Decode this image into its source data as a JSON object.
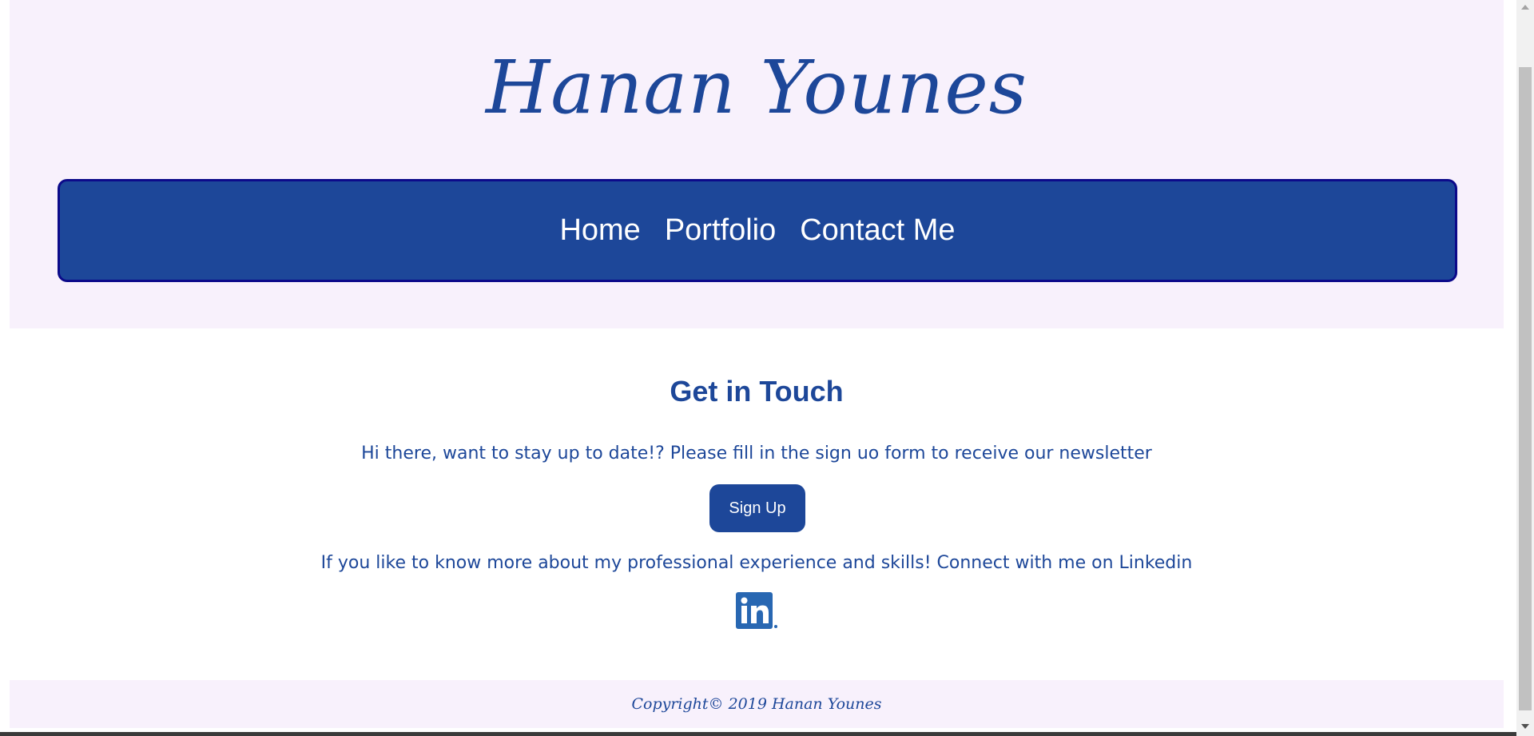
{
  "header": {
    "site_title": "Hanan Younes"
  },
  "nav": {
    "items": [
      {
        "label": "Home"
      },
      {
        "label": "Portfolio"
      },
      {
        "label": "Contact Me"
      }
    ]
  },
  "main": {
    "heading": "Get in Touch",
    "newsletter_text": "Hi there, want to stay up to date!? Please fill in the sign uo form to receive our newsletter",
    "signup_label": "Sign Up",
    "linkedin_text": "If you like to know more about my professional experience and skills! Connect with me on Linkedin",
    "linkedin_icon": "linkedin-icon"
  },
  "footer": {
    "copyright": "Copyright© 2019 Hanan Younes"
  },
  "colors": {
    "brand_blue": "#1d4799",
    "nav_border": "#0c0a8a",
    "header_bg": "#f8f1fc",
    "linkedin_blue": "#2867b2"
  }
}
